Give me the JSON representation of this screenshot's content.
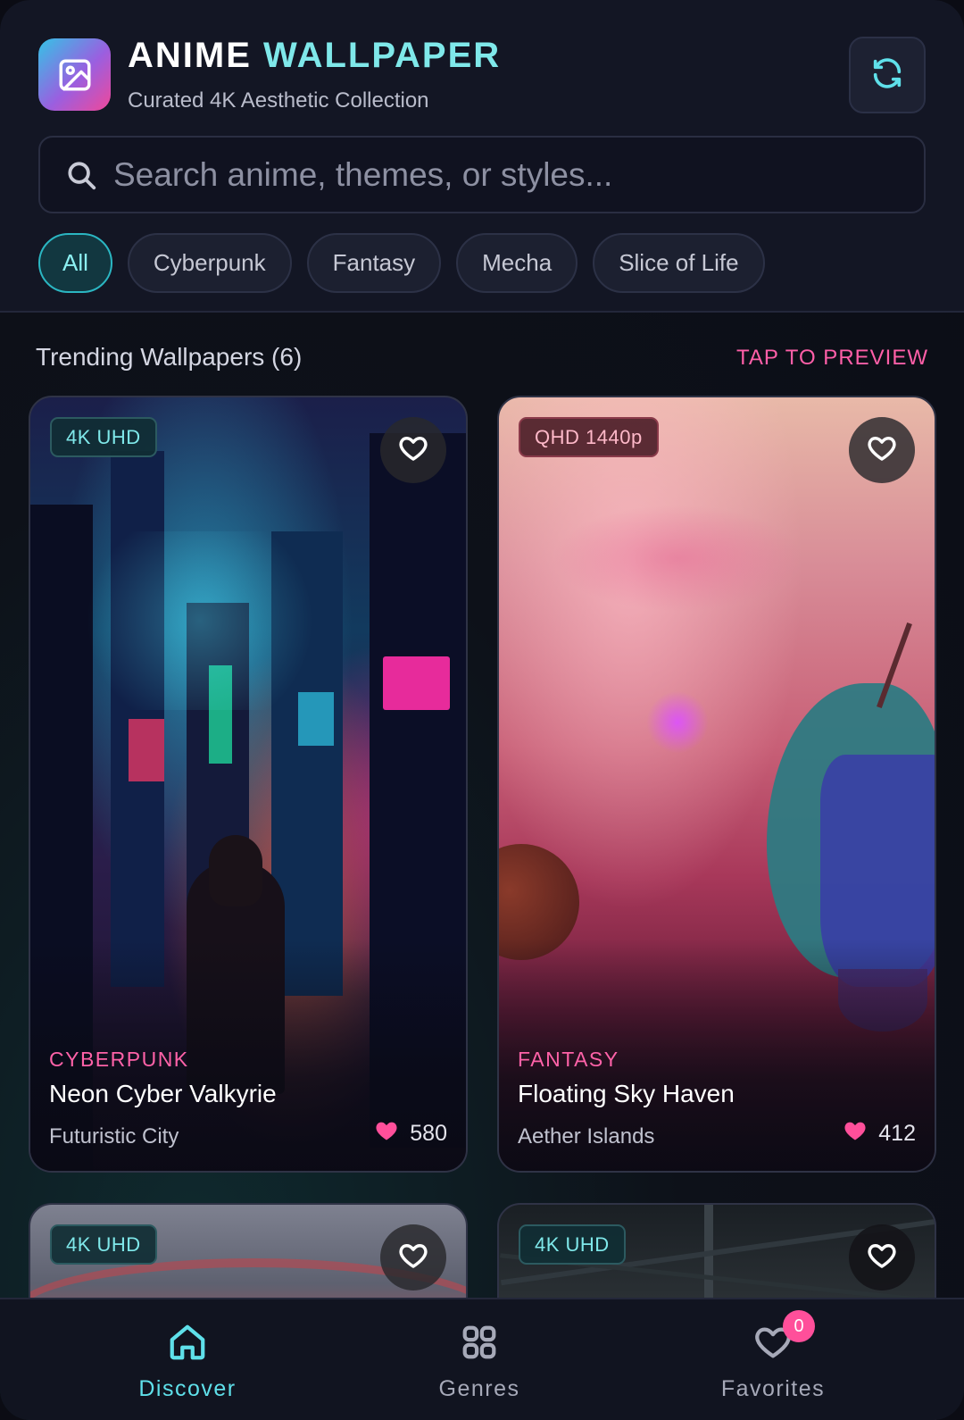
{
  "header": {
    "title_main": "ANIME",
    "title_accent": "WALLPAPER",
    "subtitle": "Curated 4K Aesthetic Collection",
    "refresh_icon": "refresh-icon",
    "app_icon": "image-icon"
  },
  "search": {
    "placeholder": "Search anime, themes, or styles...",
    "value": ""
  },
  "filters": {
    "selected": "All",
    "items": [
      "All",
      "Cyberpunk",
      "Fantasy",
      "Mecha",
      "Slice of Life"
    ]
  },
  "section": {
    "title": "Trending Wallpapers (6)",
    "action": "TAP TO PREVIEW"
  },
  "cards": [
    {
      "resolution": "4K UHD",
      "category": "CYBERPUNK",
      "title": "Neon Cyber Valkyrie",
      "subtitle": "Futuristic City",
      "likes": "580"
    },
    {
      "resolution": "QHD 1440p",
      "category": "FANTASY",
      "title": "Floating Sky Haven",
      "subtitle": "Aether Islands",
      "likes": "412"
    },
    {
      "resolution": "4K UHD"
    },
    {
      "resolution": "4K UHD"
    }
  ],
  "nav": {
    "active": "Discover",
    "items": [
      {
        "label": "Discover",
        "icon": "home-icon"
      },
      {
        "label": "Genres",
        "icon": "grid-icon"
      },
      {
        "label": "Favorites",
        "icon": "heart-icon"
      }
    ],
    "favorites_count": "0"
  },
  "colors": {
    "accent": "#5fe0ea",
    "pink": "#ff5fa8",
    "background": "#0c0d16"
  }
}
